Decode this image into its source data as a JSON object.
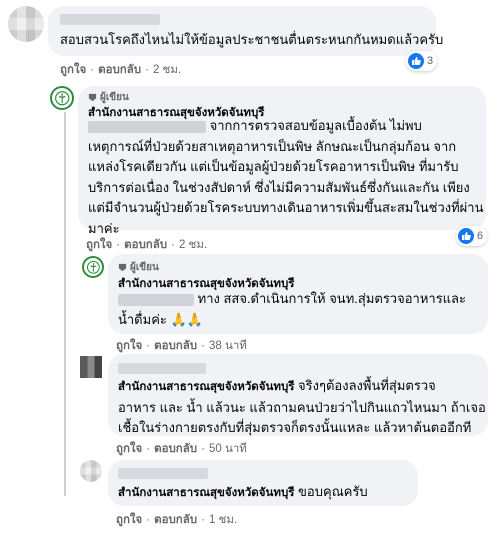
{
  "comments": [
    {
      "id": "c1",
      "author": "",
      "author_badge": "",
      "text_lines": [
        "สอบสวนโรคถึงไหนไม่ให้ข้อมูลประชาชนตื่นตระหนกกันหมดแล้วครับ"
      ],
      "like_label": "ถูกใจ",
      "reply_label": "ตอบกลับ",
      "time": "2 ชม.",
      "reaction_count": "3"
    },
    {
      "id": "c2",
      "author": "สำนักงานสาธารณสุขจังหวัดจันทบุรี",
      "author_badge": "ผู้เขียน",
      "text_lines": [
        "จากการตรวจสอบข้อมูลเบื้องต้น ไม่พบ",
        "เหตุการณ์ที่ป่วยด้วยสาเหตุอาหารเป็นพิษ ลักษณะเป็นกลุ่มก้อน จาก",
        "แหล่งโรคเดียวกัน แต่เป็นข้อมูลผู้ป่วยด้วยโรคอาหารเป็นพิษ ที่มารับ",
        "บริการต่อเนื่อง ในช่วงสัปดาห์ ซึ่งไม่มีความสัมพันธ์ซึ่งกันและกัน เพียง",
        "แต่มีจำนวนผู้ป่วยด้วยโรคระบบทางเดินอาหารเพิ่มขึ้นสะสมในช่วงที่ผ่าน",
        "มาค่ะ"
      ],
      "like_label": "ถูกใจ",
      "reply_label": "ตอบกลับ",
      "time": "2 ชม.",
      "reaction_count": "6"
    },
    {
      "id": "c3",
      "author": "สำนักงานสาธารณสุขจังหวัดจันทบุรี",
      "author_badge": "ผู้เขียน",
      "text_lines": [
        "ทาง สสจ.ดำเนินการให้ จนท.สุ่มตรวจอาหารและ",
        "น้ำดื่มค่ะ 🙏🙏"
      ],
      "like_label": "ถูกใจ",
      "reply_label": "ตอบกลับ",
      "time": "38 นาที",
      "reaction_count": ""
    },
    {
      "id": "c4",
      "author": "",
      "author_badge": "",
      "mention": "สำนักงานสาธารณสุขจังหวัดจันทบุรี",
      "text_lines": [
        " จริงๆต้องลงพื้นที่สุ่มตรวจ",
        "อาหาร และ น้ำ แล้วนะ แล้วถามคนป่วยว่าไปกินแถวไหนมา ถ้าเจอ",
        "เชื้อในร่างกายตรงกับที่สุ่มตรวจก็ตรงนั้นแหละ แล้วหาต้นตออีกที"
      ],
      "like_label": "ถูกใจ",
      "reply_label": "ตอบกลับ",
      "time": "50 นาที",
      "reaction_count": ""
    },
    {
      "id": "c5",
      "author": "",
      "author_badge": "",
      "mention": "สำนักงานสาธารณสุขจังหวัดจันทบุรี",
      "text_lines": [
        " ขอบคุณครับ"
      ],
      "like_label": "ถูกใจ",
      "reply_label": "ตอบกลับ",
      "time": "1 ชม.",
      "reaction_count": ""
    }
  ],
  "separator": "·",
  "icons": {
    "like": "like-icon",
    "author_tag": "author-badge-icon",
    "logo": "health-office-logo-icon"
  },
  "colors": {
    "bubble": "#f0f2f5",
    "like": "#1877f2",
    "meta": "#65676b",
    "logo_green": "#2e8b3a"
  }
}
